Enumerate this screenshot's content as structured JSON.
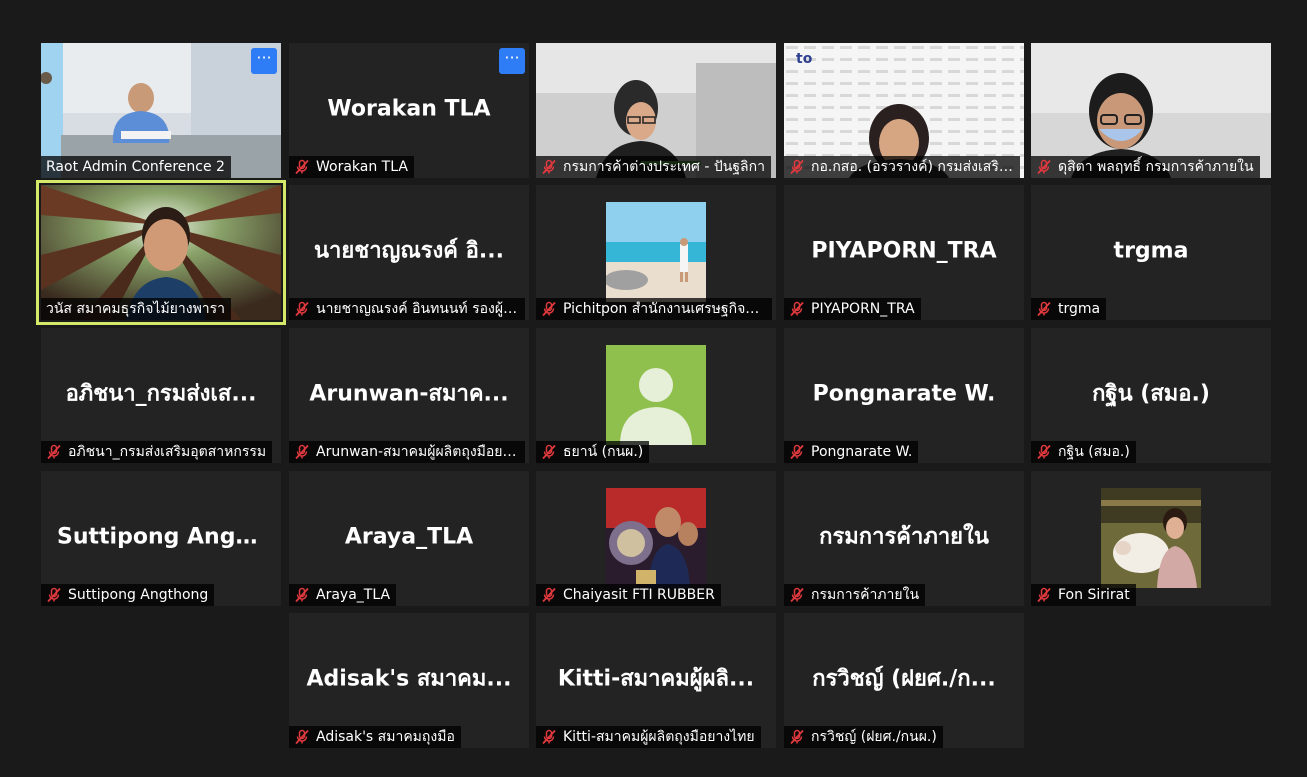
{
  "tiles": [
    {
      "id": "t0",
      "label": "Raot Admin Conference 2",
      "muted": false,
      "type": "video-office",
      "more": true
    },
    {
      "id": "t1",
      "big": "Worakan TLA",
      "label": "Worakan TLA",
      "muted": true,
      "type": "name",
      "more": true
    },
    {
      "id": "t2",
      "label": "กรมการค้าต่างประเทศ - ปันฐลิกา",
      "muted": true,
      "type": "video-woman-glasses"
    },
    {
      "id": "t3",
      "label": "กอ.กสอ. (อรวรางค์) กรมส่งเสริมอุ...",
      "muted": true,
      "type": "video-pattern"
    },
    {
      "id": "t4",
      "label": "ดุสิตา พลฤทธิ์ กรมการค้าภายใน",
      "muted": true,
      "type": "video-mask"
    },
    {
      "id": "t5",
      "label": "วนัส สมาคมธุรกิจไม้ยางพารา",
      "muted": false,
      "type": "video-forest",
      "active": true
    },
    {
      "id": "t6",
      "big": "นายชาญณรงค์ อิ...",
      "label": "นายชาญณรงค์ อินทนนท์ รองผู้อ...",
      "muted": true,
      "type": "name"
    },
    {
      "id": "t7",
      "label": "Pichitpon สำนักงานเศรษฐกิจอุต...",
      "muted": true,
      "type": "avatar-beach"
    },
    {
      "id": "t8",
      "big": "PIYAPORN_TRA",
      "label": "PIYAPORN_TRA",
      "muted": true,
      "type": "name"
    },
    {
      "id": "t9",
      "big": "trgma",
      "label": "trgma",
      "muted": true,
      "type": "name"
    },
    {
      "id": "t10",
      "big": "อภิชนา_กรมส่งเส...",
      "label": "อภิชนา_กรมส่งเสริมอุตสาหกรรม",
      "muted": true,
      "type": "name"
    },
    {
      "id": "t11",
      "big": "Arunwan-สมาค...",
      "label": "Arunwan-สมาคมผู้ผลิตถุงมือยา...",
      "muted": true,
      "type": "name"
    },
    {
      "id": "t12",
      "label": "ธยาน์ (กนผ.)",
      "muted": true,
      "type": "avatar-default"
    },
    {
      "id": "t13",
      "big": "Pongnarate W.",
      "label": "Pongnarate W.",
      "muted": true,
      "type": "name"
    },
    {
      "id": "t14",
      "big": "กฐิน (สมอ.)",
      "label": "กฐิน (สมอ.)",
      "muted": true,
      "type": "name"
    },
    {
      "id": "t15",
      "big": "Suttipong  Angt...",
      "label": "Suttipong Angthong",
      "muted": true,
      "type": "name"
    },
    {
      "id": "t16",
      "big": "Araya_TLA",
      "label": "Araya_TLA",
      "muted": true,
      "type": "name"
    },
    {
      "id": "t17",
      "label": "Chaiyasit FTI RUBBER",
      "muted": true,
      "type": "avatar-group"
    },
    {
      "id": "t18",
      "big": "กรมการค้าภายใน",
      "label": "กรมการค้าภายใน",
      "muted": true,
      "type": "name"
    },
    {
      "id": "t19",
      "label": "Fon Sirirat",
      "muted": true,
      "type": "avatar-sheep"
    },
    {
      "id": "t20",
      "big": "Adisak's สมาคม...",
      "label": "Adisak's สมาคมถุงมือ",
      "muted": true,
      "type": "name"
    },
    {
      "id": "t21",
      "big": "Kitti-สมาคมผู้ผลิ...",
      "label": "Kitti-สมาคมผู้ผลิตถุงมือยางไทย",
      "muted": true,
      "type": "name"
    },
    {
      "id": "t22",
      "big": "กรวิชญ์ (ฝยศ./ก...",
      "label": "กรวิชญ์ (ฝยศ./กนผ.)",
      "muted": true,
      "type": "name"
    }
  ],
  "more_label": "···",
  "colors": {
    "tile": "#232323",
    "background": "#1a1a1a",
    "active_border": "#d4e86a",
    "more_button": "#2e7cf6",
    "muted_icon": "#e0393e"
  }
}
